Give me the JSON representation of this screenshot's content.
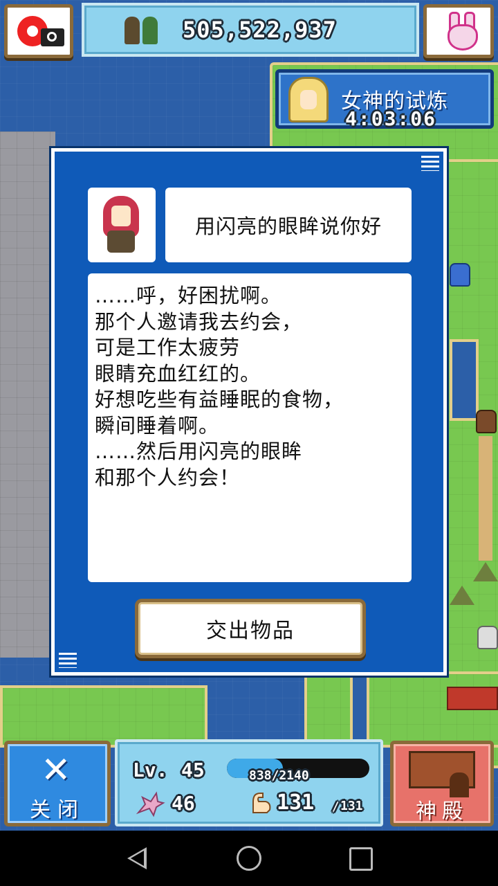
{
  "top_bar": {
    "gold": "505,522,937"
  },
  "trial": {
    "title": "女神的试炼",
    "timer": "4:03:06"
  },
  "dialog": {
    "title": "用闪亮的眼眸说你好",
    "message_lines": [
      "……呼，好困扰啊。",
      "那个人邀请我去约会，",
      "可是工作太疲劳",
      "眼睛充血红红的。",
      "好想吃些有益睡眠的食物，",
      "瞬间睡着啊。",
      "……然后用闪亮的眼眸",
      "和那个人约会！"
    ],
    "hand_in_button": "交出物品"
  },
  "bottom_bar": {
    "close_label": "关闭",
    "level_label": "Lv.",
    "level": "45",
    "exp_text": "838/2140",
    "exp_fraction": 0.392,
    "power": "46",
    "stamina": "131",
    "stamina_sep": "/",
    "stamina_max": "131",
    "temple_label": "神殿"
  },
  "icons": {
    "camera": "camera-record-icon",
    "bunny": "bunny-icon",
    "close": "close-x-icon",
    "dragon": "dragon-icon",
    "arm": "flexed-arm-icon",
    "temple": "temple-icon"
  }
}
